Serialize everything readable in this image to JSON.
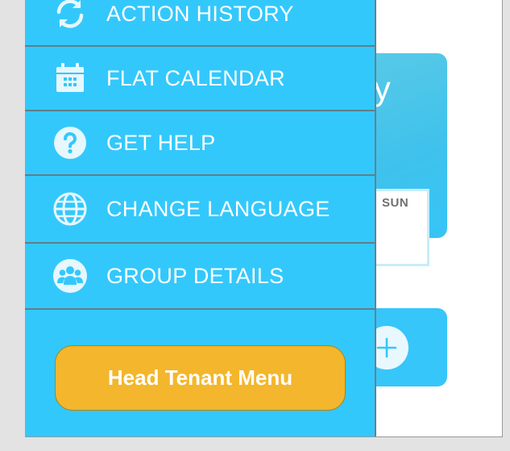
{
  "background": {
    "month_title": "July",
    "day_label": "SUN"
  },
  "drawer": {
    "items": [
      {
        "label": "ACTION HISTORY",
        "icon": "refresh-icon"
      },
      {
        "label": "FLAT CALENDAR",
        "icon": "calendar-icon"
      },
      {
        "label": "GET HELP",
        "icon": "help-icon"
      },
      {
        "label": "CHANGE LANGUAGE",
        "icon": "globe-icon"
      },
      {
        "label": "GROUP DETAILS",
        "icon": "group-icon"
      }
    ],
    "head_tenant_button": "Head Tenant Menu"
  },
  "colors": {
    "drawer_bg": "#33c8fc",
    "button_yellow": "#f3b62c",
    "icon_fill": "#e6f7fd",
    "divider": "#5d7f8b"
  }
}
